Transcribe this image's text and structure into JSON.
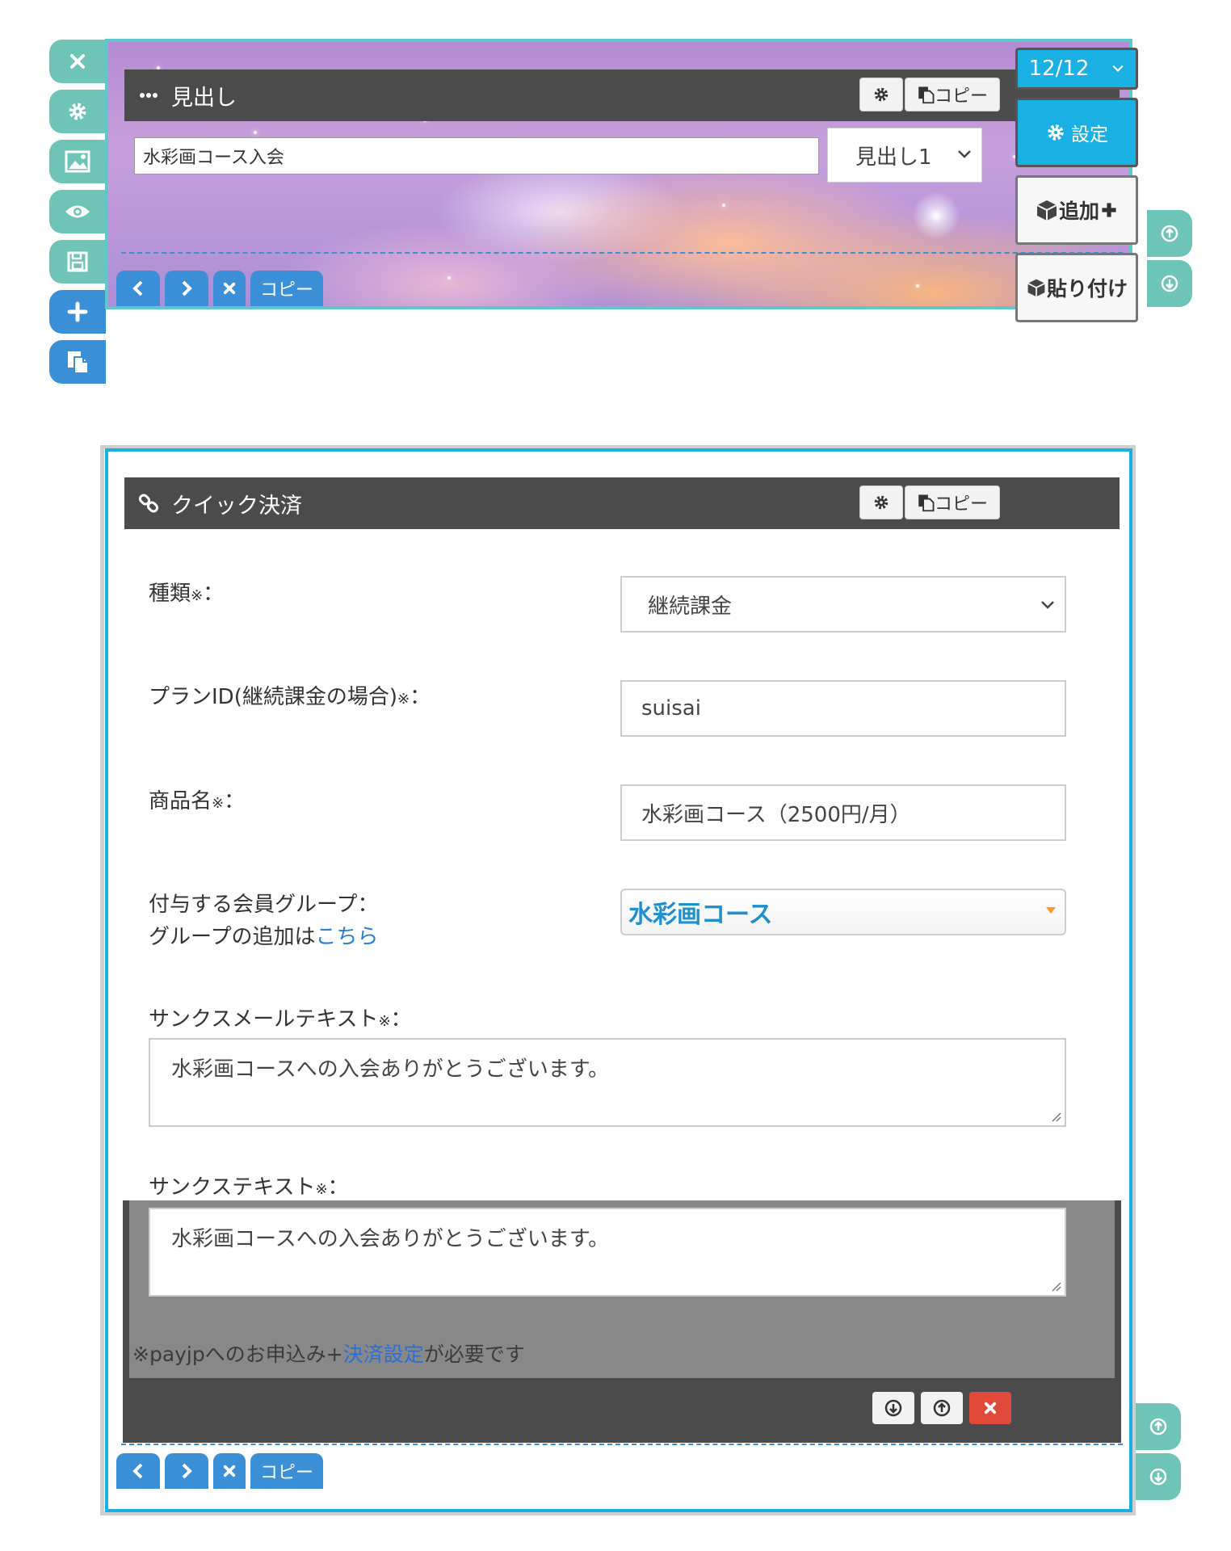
{
  "left_toolbar": {
    "icons": [
      "close-icon",
      "gear-icon",
      "image-icon",
      "eye-icon",
      "save-icon",
      "plus-icon",
      "copy-icon"
    ]
  },
  "block1": {
    "title": "見出し",
    "copy_label": "コピー",
    "heading_value": "水彩画コース入会",
    "heading_level": "見出し1",
    "nav_copy": "コピー"
  },
  "right_panel": {
    "page_counter": "12/12",
    "settings": "設定",
    "add": "追加",
    "paste": "貼り付け"
  },
  "block2": {
    "title": "クイック決済",
    "copy_label": "コピー",
    "fields": {
      "type_label": "種類",
      "type_value": "継続課金",
      "plan_label": "プランID(継続課金の場合)",
      "plan_value": "suisai",
      "product_label": "商品名",
      "product_value": "水彩画コース（2500円/月）",
      "group_label": "付与する会員グループ：",
      "group_add_prefix": "グループの追加は",
      "group_add_link": "こちら",
      "group_value": "水彩画コース",
      "thanks_mail_label": "サンクスメールテキスト",
      "thanks_mail_value": "水彩画コースへの入会ありがとうございます。",
      "thanks_label": "サンクステキスト",
      "thanks_value": "水彩画コースへの入会ありがとうございます。",
      "required_mark": "※",
      "colon": "："
    },
    "note_prefix": "※payjpへのお申込み+",
    "note_link": "決済設定",
    "note_suffix": "が必要です",
    "nav_copy": "コピー"
  },
  "colors": {
    "teal": "#6fc4b8",
    "blue": "#3a8fd6",
    "cyan": "#1ab0e4",
    "header": "#4b4b4b",
    "link": "#2a7fd6",
    "danger": "#e14a3a"
  }
}
